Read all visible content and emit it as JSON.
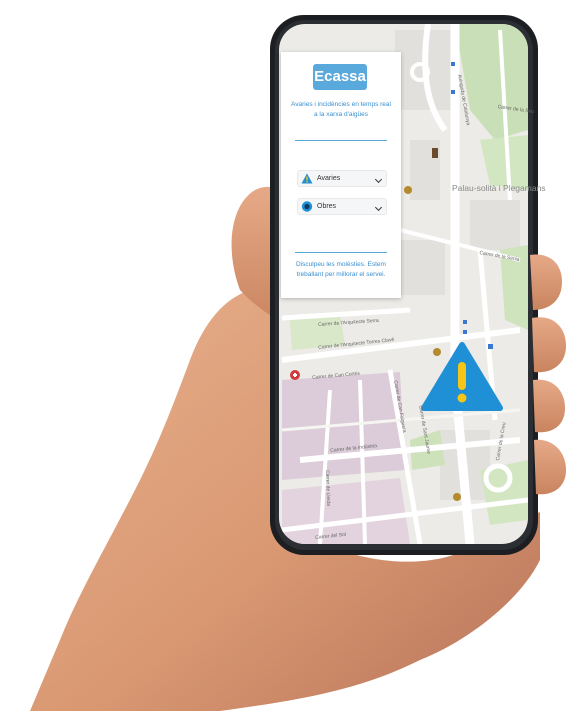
{
  "panel": {
    "logo_text": "Ecassa",
    "tagline": "Avaries i incidències en temps real a la xarxa d'aigües",
    "filters": [
      {
        "label": "Avaries",
        "icon": "warning-triangle-icon"
      },
      {
        "label": "Obres",
        "icon": "works-circle-icon"
      }
    ],
    "notice": "Disculpeu les molèsties. Estem treballant per millorar el servei."
  },
  "map": {
    "town_label": "Palau-solità i Plegamans",
    "streets": [
      "Carrer de Sant Jaume",
      "Avinguda de Catalunya",
      "Carrer de la Seu",
      "Carrer de l'Arquitecte Serra",
      "Carrer de l'Arquitecte Torres Clavé",
      "Carrer de Can Cortés",
      "Carrer de la Indústria",
      "Carrer del Sol",
      "Carrer de Lleida",
      "Carrer de la Sènia",
      "Carrer de Can Falguera",
      "Carrer de la Creu"
    ],
    "alert_icon": "warning-triangle-icon"
  },
  "colors": {
    "accent": "#3a8fd0",
    "logo_bg": "#5aa9dd",
    "alert": "#1f8fd6",
    "alert_mark": "#f5c518"
  }
}
